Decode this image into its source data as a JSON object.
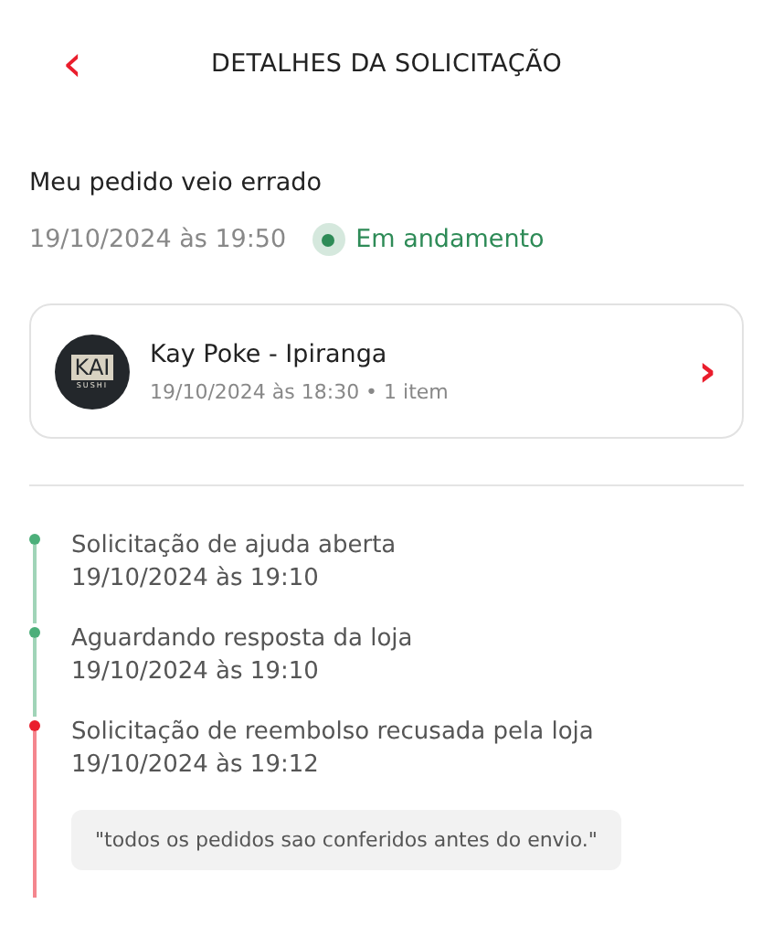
{
  "header": {
    "back": "‹",
    "title": "DETALHES DA SOLICITAÇÃO"
  },
  "request": {
    "title": "Meu pedido veio errado",
    "date": "19/10/2024 às 19:50",
    "status": {
      "label": "Em andamento",
      "color": "#2e8b57"
    }
  },
  "store": {
    "logo_text": "KAI",
    "logo_subtext": "SUSHI",
    "name": "Kay Poke - Ipiranga",
    "details": "19/10/2024 às 18:30 • 1 item",
    "chevron": "›"
  },
  "timeline": [
    {
      "title": "Solicitação de ajuda aberta",
      "date": "19/10/2024 às 19:10",
      "color": "#4caf7a"
    },
    {
      "title": "Aguardando resposta da loja",
      "date": "19/10/2024 às 19:10",
      "color": "#4caf7a"
    },
    {
      "title": "Solicitação de reembolso recusada pela loja",
      "date": "19/10/2024 às 19:12",
      "color": "#ea1d2c",
      "note": "\"todos os pedidos sao conferidos antes do envio.\""
    }
  ]
}
